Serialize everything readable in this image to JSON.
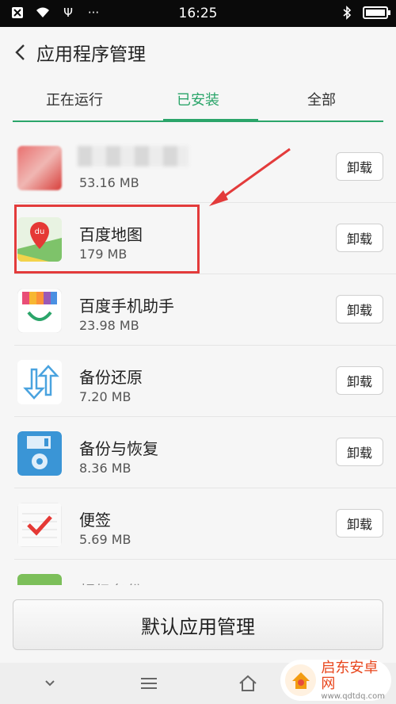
{
  "statusbar": {
    "time": "16:25",
    "usb_symbol": "Ψ",
    "dots": "···"
  },
  "titlebar": {
    "title": "应用程序管理"
  },
  "tabs": [
    {
      "label": "正在运行"
    },
    {
      "label": "已安装"
    },
    {
      "label": "全部"
    }
  ],
  "apps": [
    {
      "name": "",
      "size": "53.16 MB",
      "uninstall": "卸载"
    },
    {
      "name": "百度地图",
      "size": "179 MB",
      "uninstall": "卸载",
      "icon_text": "du"
    },
    {
      "name": "百度手机助手",
      "size": "23.98 MB",
      "uninstall": "卸载"
    },
    {
      "name": "备份还原",
      "size": "7.20 MB",
      "uninstall": "卸载"
    },
    {
      "name": "备份与恢复",
      "size": "8.36 MB",
      "uninstall": "卸载"
    },
    {
      "name": "便签",
      "size": "5.69 MB",
      "uninstall": "卸载"
    },
    {
      "name": "超级备份"
    }
  ],
  "bottom_button": "默认应用管理",
  "watermark": {
    "title": "启东安卓网",
    "url": "www.qdtdq.com"
  },
  "colors": {
    "accent": "#2ba56a",
    "highlight": "#e33b3b"
  }
}
